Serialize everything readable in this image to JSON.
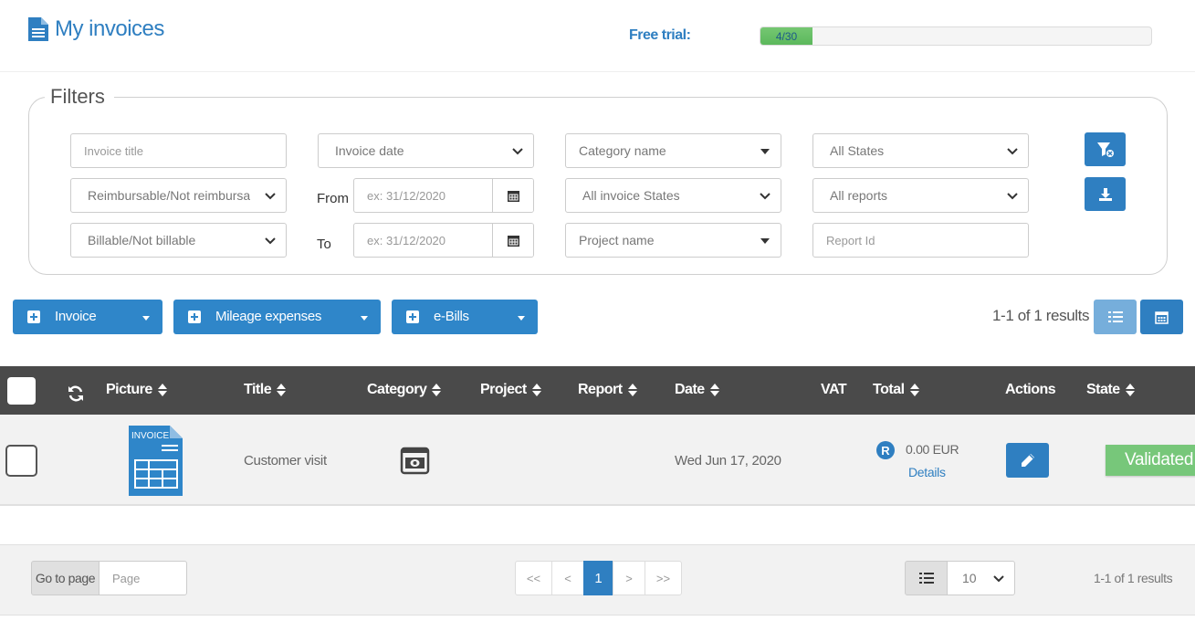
{
  "header": {
    "title": "My invoices",
    "title_icon": "document-icon",
    "trial_label": "Free trial:",
    "trial_progress_text": "4/30",
    "trial_progress_fraction": 0.1333
  },
  "filters": {
    "legend": "Filters",
    "invoice_title_placeholder": "Invoice title",
    "invoice_date": "Invoice date",
    "category_name": "Category name",
    "all_states": "All States",
    "reimbursable": "Reimbursable/Not reimbursable",
    "from_label": "From",
    "from_placeholder": "ex: 31/12/2020",
    "all_invoice_states": "All invoice States",
    "all_reports": "All reports",
    "billable": "Billable/Not billable",
    "to_label": "To",
    "to_placeholder": "ex: 31/12/2020",
    "project_name": "Project name",
    "report_id_placeholder": "Report Id"
  },
  "toolbar": {
    "invoice_button": "Invoice",
    "mileage_button": "Mileage expenses",
    "ebills_button": "e-Bills",
    "results_text": "1-1 of 1 results"
  },
  "table": {
    "columns": [
      "Picture",
      "Title",
      "Category",
      "Project",
      "Report",
      "Date",
      "VAT",
      "Total",
      "Actions",
      "State"
    ],
    "rows": [
      {
        "picture_label": "INVOICE",
        "title": "Customer visit",
        "category_icon": "cash-icon",
        "project": "",
        "report": "",
        "date": "Wed Jun 17, 2020",
        "vat": "",
        "total_badge": "R",
        "total": "0.00 EUR",
        "details_link": "Details",
        "state": "Validated"
      }
    ]
  },
  "footer": {
    "goto_label": "Go to page",
    "page_placeholder": "Page",
    "pager": {
      "first": "<<",
      "prev": "<",
      "current": "1",
      "next": ">",
      "last": ">>"
    },
    "page_size": "10",
    "results_text": "1-1 of 1 results"
  },
  "colors": {
    "accent": "#2f7fc1",
    "header_bg": "#4a4a4a",
    "success": "#77c77a"
  }
}
